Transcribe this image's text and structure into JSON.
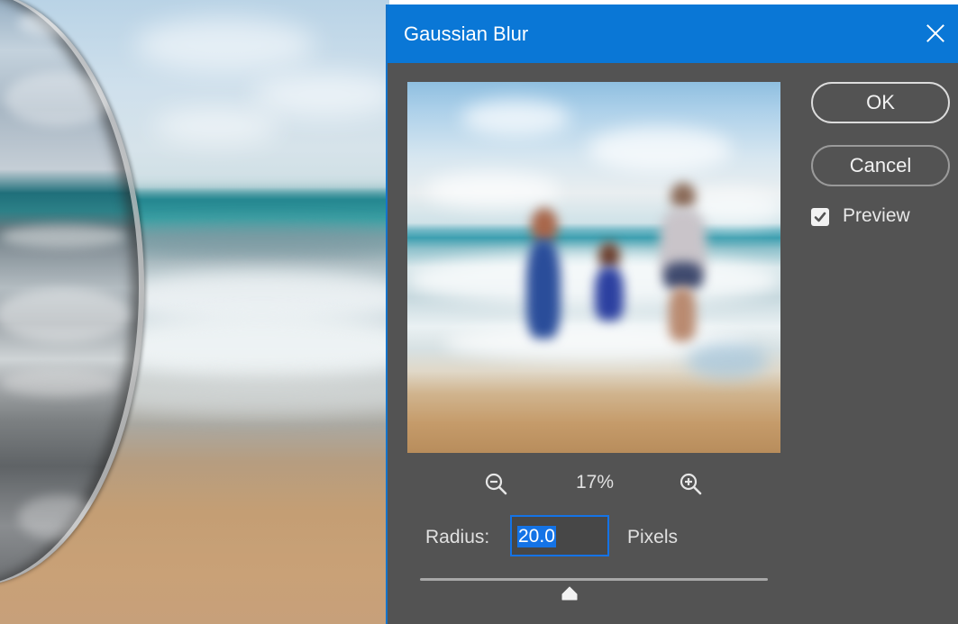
{
  "dialog": {
    "title": "Gaussian Blur",
    "ok_label": "OK",
    "cancel_label": "Cancel",
    "preview_label": "Preview",
    "preview_checked": true
  },
  "zoom": {
    "level": "17%"
  },
  "radius": {
    "label": "Radius:",
    "value": "20.0",
    "unit": "Pixels",
    "slider_fraction": 0.43
  },
  "colors": {
    "titlebar": "#0a77d6",
    "dialog_bg": "#535353",
    "accent": "#1473e6"
  },
  "icons": {
    "close": "close-icon",
    "zoom_out": "zoom-out-icon",
    "zoom_in": "zoom-in-icon",
    "checkbox": "checkmark-icon",
    "slider_thumb": "slider-thumb-icon"
  }
}
